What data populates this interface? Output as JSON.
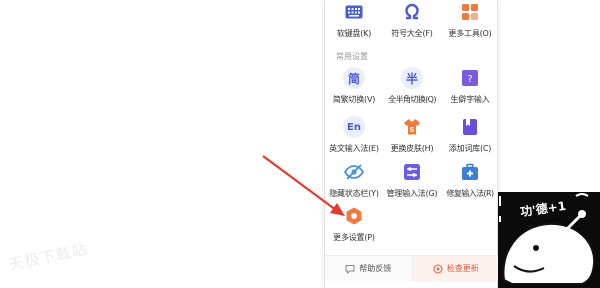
{
  "watermark": "天极下载站",
  "menu": {
    "top_row": [
      {
        "label": "软键盘(K)",
        "icon": "keyboard-icon"
      },
      {
        "label": "符号大全(F)",
        "icon": "omega-icon"
      },
      {
        "label": "更多工具(O)",
        "icon": "more-tools-icon"
      }
    ],
    "section_title": "常用设置",
    "rows": [
      [
        {
          "label": "简繁切换(V)",
          "icon": "simplified-icon",
          "glyph": "简"
        },
        {
          "label": "全半角切换(Q)",
          "icon": "halfwidth-icon",
          "glyph": "半"
        },
        {
          "label": "生僻字输入",
          "icon": "rare-char-icon"
        }
      ],
      [
        {
          "label": "英文输入法(E)",
          "icon": "english-icon",
          "glyph": "En"
        },
        {
          "label": "更换皮肤(H)",
          "icon": "skin-icon"
        },
        {
          "label": "添加词库(C)",
          "icon": "dictionary-icon"
        }
      ],
      [
        {
          "label": "隐藏状态栏(Y)",
          "icon": "hide-eye-icon"
        },
        {
          "label": "管理输入法(G)",
          "icon": "manage-icon"
        },
        {
          "label": "修复输入法(R)",
          "icon": "repair-icon"
        }
      ],
      [
        {
          "label": "更多设置(P)",
          "icon": "settings-hex-icon"
        }
      ]
    ],
    "footer": {
      "help": "帮助反馈",
      "update": "检查更新"
    }
  },
  "mascot_text": "功'德+1",
  "colors": {
    "accent_blue": "#4a5bd6",
    "accent_orange": "#f0793f",
    "arrow_red": "#e4392b"
  }
}
